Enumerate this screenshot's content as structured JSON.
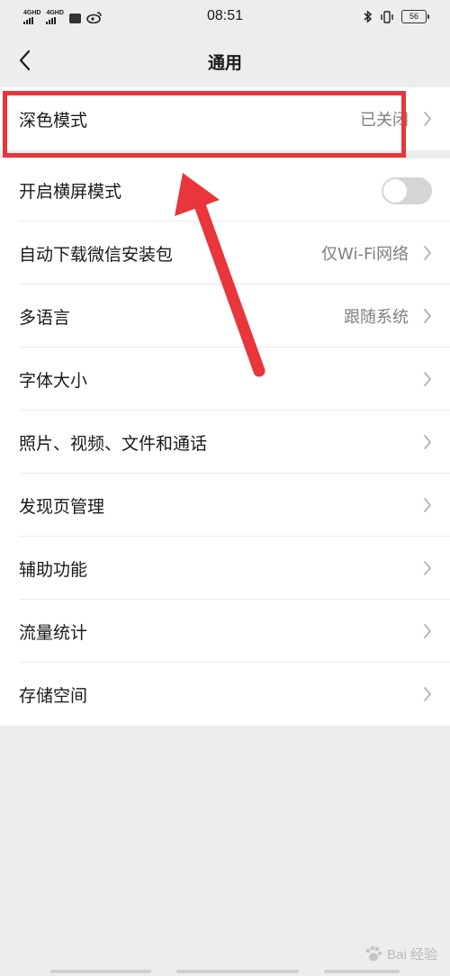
{
  "status_bar": {
    "network_1": "4GHD",
    "network_2": "4GHD",
    "time": "08:51",
    "battery": "56"
  },
  "header": {
    "title": "通用"
  },
  "settings": [
    {
      "label": "深色模式",
      "value": "已关闭",
      "type": "link"
    },
    {
      "label": "开启横屏模式",
      "type": "toggle",
      "on": false
    },
    {
      "label": "自动下载微信安装包",
      "value": "仅Wi-Fi网络",
      "type": "link"
    },
    {
      "label": "多语言",
      "value": "跟随系统",
      "type": "link"
    },
    {
      "label": "字体大小",
      "type": "link"
    },
    {
      "label": "照片、视频、文件和通话",
      "type": "link"
    },
    {
      "label": "发现页管理",
      "type": "link"
    },
    {
      "label": "辅助功能",
      "type": "link"
    },
    {
      "label": "流量统计",
      "type": "link"
    },
    {
      "label": "存储空间",
      "type": "link"
    }
  ],
  "annotation": {
    "color": "#e8363a"
  },
  "watermark": {
    "text": "Bai 经验"
  },
  "icons": {
    "back": "chevron-left-icon",
    "row_arrow": "chevron-right-icon",
    "bluetooth": "bluetooth-icon",
    "vibrate": "vibrate-icon",
    "weibo": "weibo-icon"
  }
}
